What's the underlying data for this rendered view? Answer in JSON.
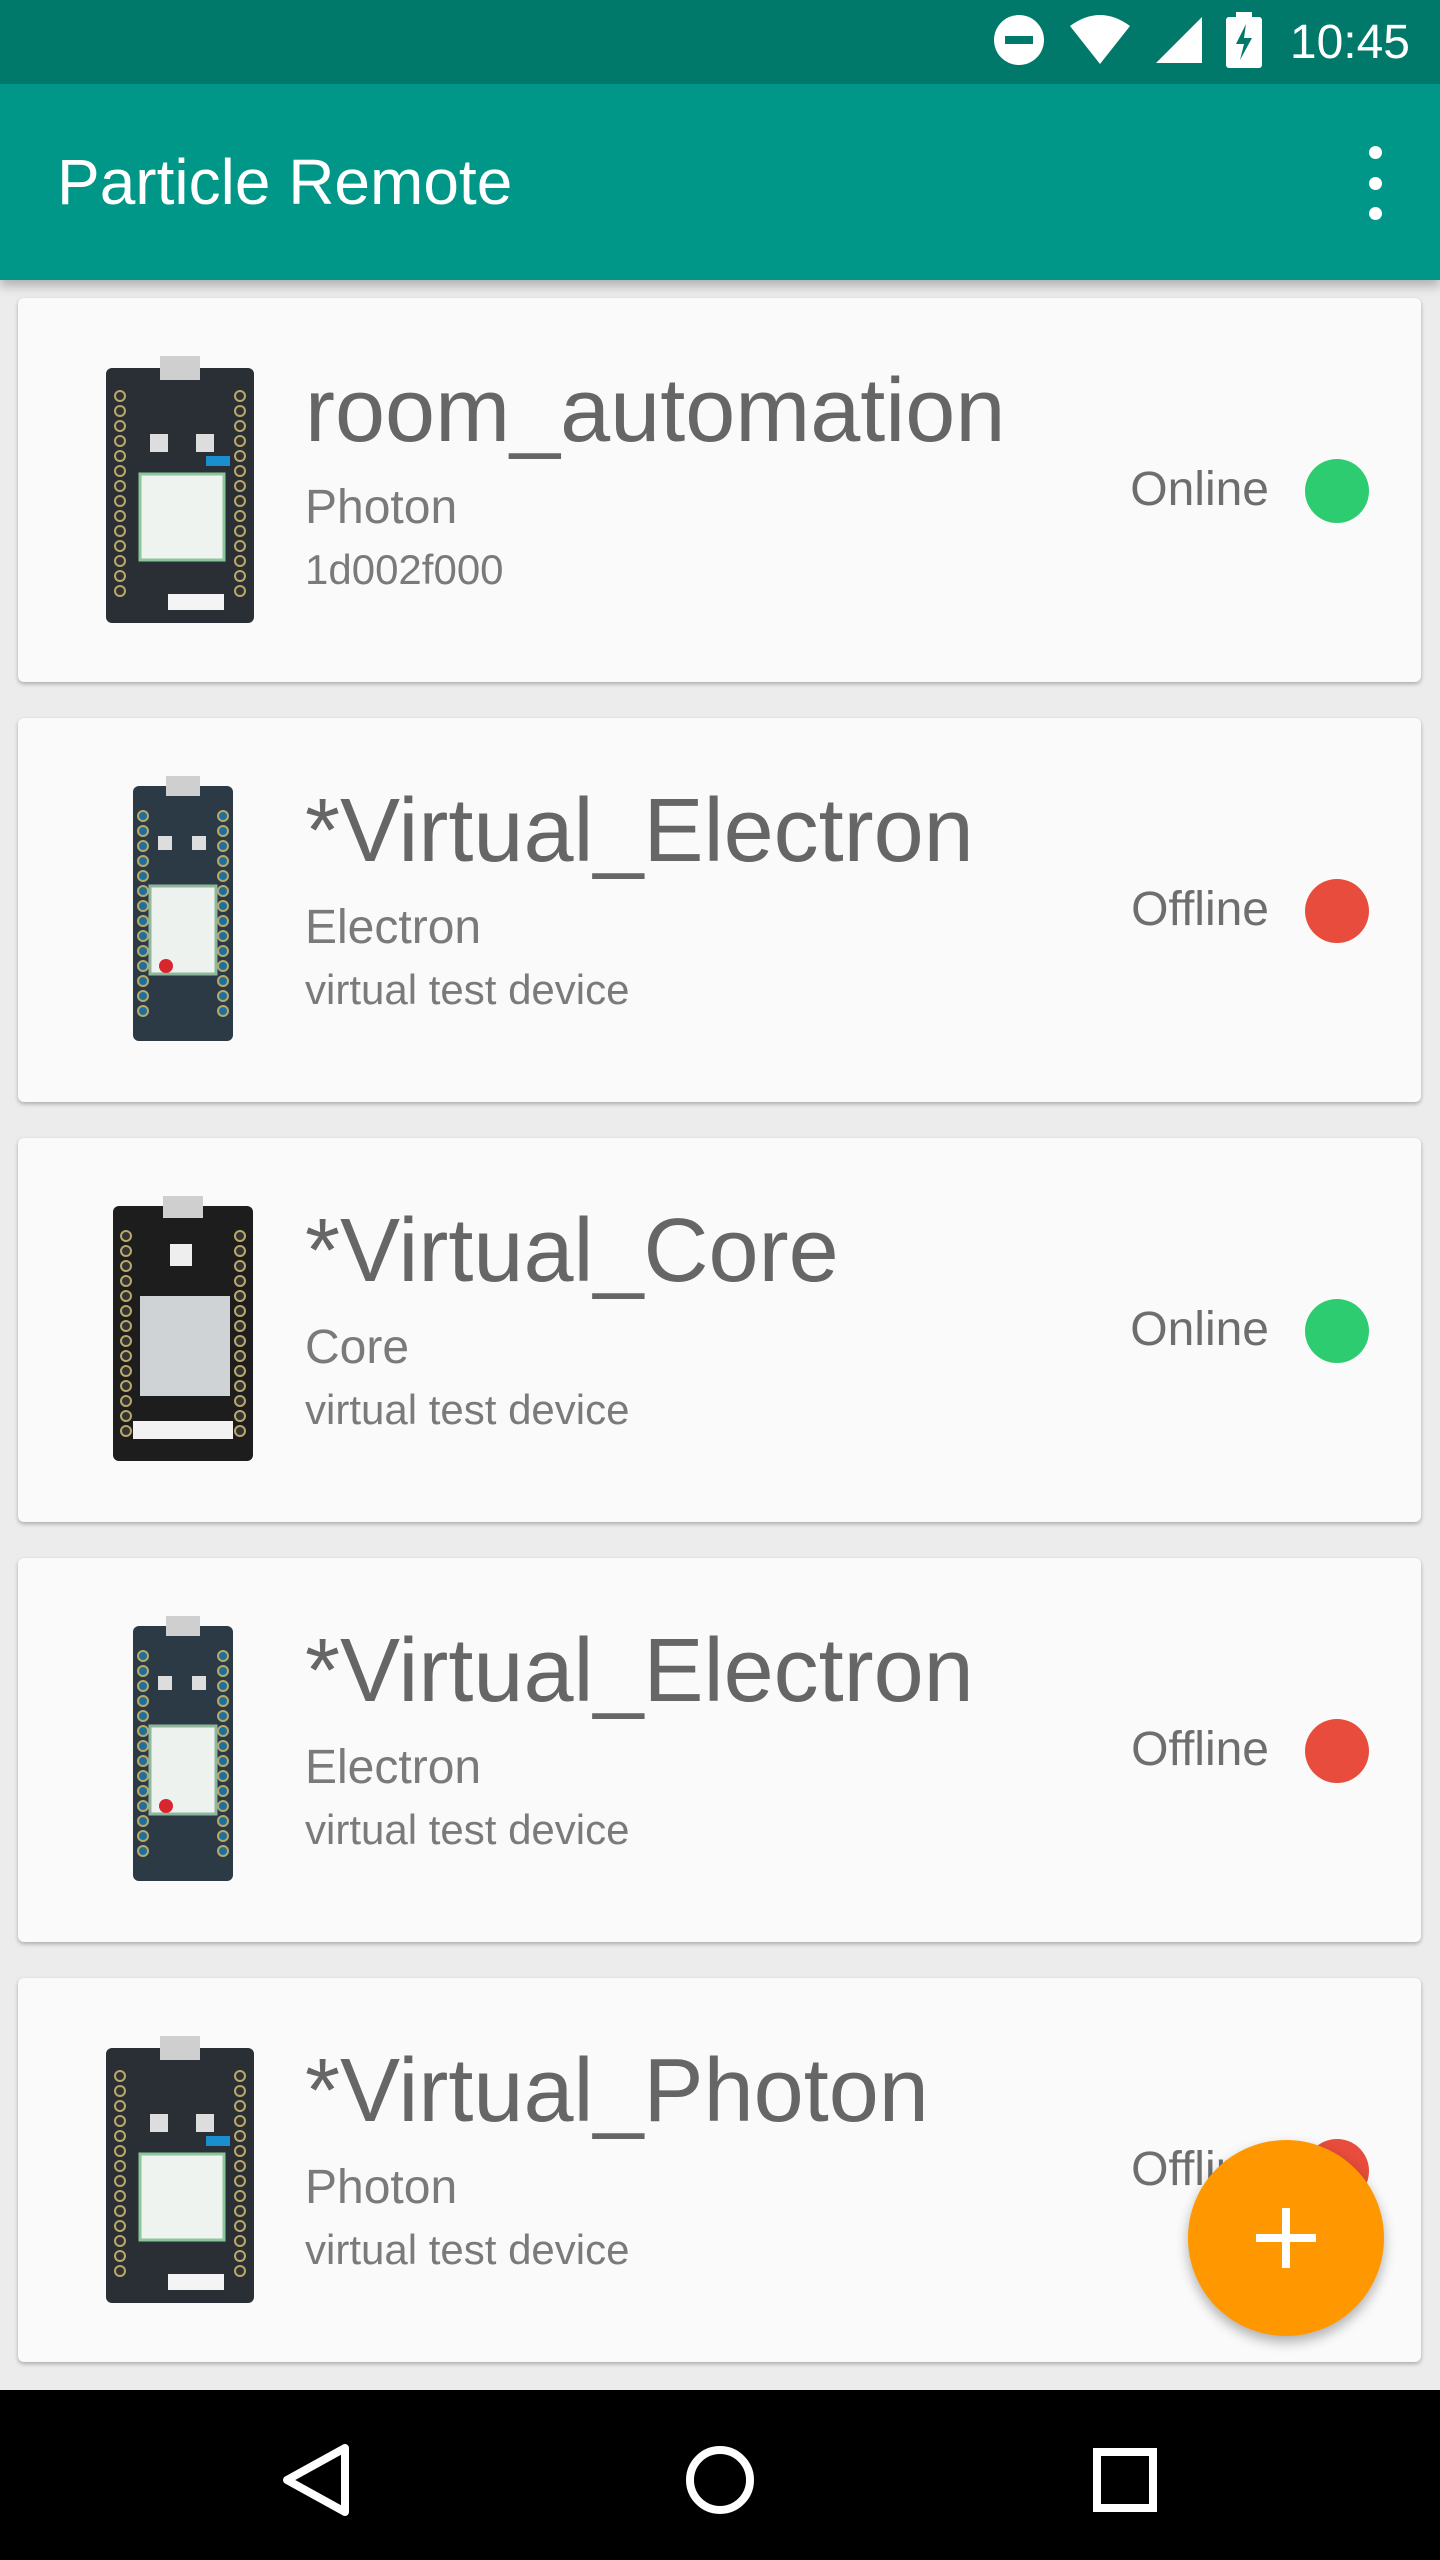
{
  "status_bar": {
    "time": "10:45",
    "icons": [
      "do-not-disturb-icon",
      "wifi-icon",
      "signal-icon",
      "battery-charging-icon"
    ]
  },
  "app_bar": {
    "title": "Particle Remote",
    "menu_icon": "overflow-menu-icon"
  },
  "devices": [
    {
      "name": "room_automation",
      "type": "Photon",
      "description": "1d002f000",
      "status": "Online",
      "status_color": "#2ecc71",
      "image": "photon-board"
    },
    {
      "name": "*Virtual_Electron",
      "type": "Electron",
      "description": "virtual test device",
      "status": "Offline",
      "status_color": "#e74c3c",
      "image": "electron-board"
    },
    {
      "name": "*Virtual_Core",
      "type": "Core",
      "description": "virtual test device",
      "status": "Online",
      "status_color": "#2ecc71",
      "image": "core-board"
    },
    {
      "name": "*Virtual_Electron",
      "type": "Electron",
      "description": "virtual test device",
      "status": "Offline",
      "status_color": "#e74c3c",
      "image": "electron-board"
    },
    {
      "name": "*Virtual_Photon",
      "type": "Photon",
      "description": "virtual test device",
      "status": "Offline",
      "status_color": "#e74c3c",
      "image": "photon-board"
    }
  ],
  "fab": {
    "icon": "plus-icon",
    "color": "#ff9800"
  },
  "nav_bar": {
    "icons": [
      "back-icon",
      "home-icon",
      "recents-icon"
    ]
  },
  "colors": {
    "status_bar": "#00796b",
    "app_bar": "#009688",
    "accent": "#ff9800"
  }
}
